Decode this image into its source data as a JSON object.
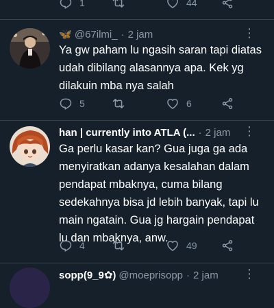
{
  "top_actions": {
    "reply_count": "1",
    "retweet_count": "",
    "like_count": "44"
  },
  "tweets": [
    {
      "display_name": "",
      "handle": "🦋 @67ilmi_",
      "separator": "·",
      "time": "2 jam",
      "more": "⋮",
      "text": "Ya gw paham lu ngasih saran tapi diatas udah dibilang alasannya apa. Kek yg dilakuin mba nya salah",
      "reply_count": "5",
      "retweet_count": "",
      "like_count": "6"
    },
    {
      "display_name": "han | currently into ATLA (...",
      "handle": "",
      "separator": "·",
      "time": "2 jam",
      "more": "⋮",
      "text": "Ga perlu kasar kan? Gua juga ga ada menyiratkan adanya kesalahan dalam pendapat mbaknya, cuma bilang sedekahnya bisa jd lebih banyak, tapi lu main ngatain. Gua jg hargain pendapat lu dan mbaknya, anw.",
      "reply_count": "4",
      "retweet_count": "",
      "like_count": "49"
    },
    {
      "display_name": "sopp(9_9✿)",
      "handle": "@moeprisopp",
      "separator": "·",
      "time": "2 jam",
      "more": "⋮"
    }
  ],
  "icons": [
    "reply-icon",
    "retweet-icon",
    "like-icon",
    "share-icon",
    "more-icon"
  ],
  "colors": {
    "background": "#15202b",
    "text": "#ffffff",
    "secondary": "#8b98a5",
    "divider": "#38444d"
  }
}
